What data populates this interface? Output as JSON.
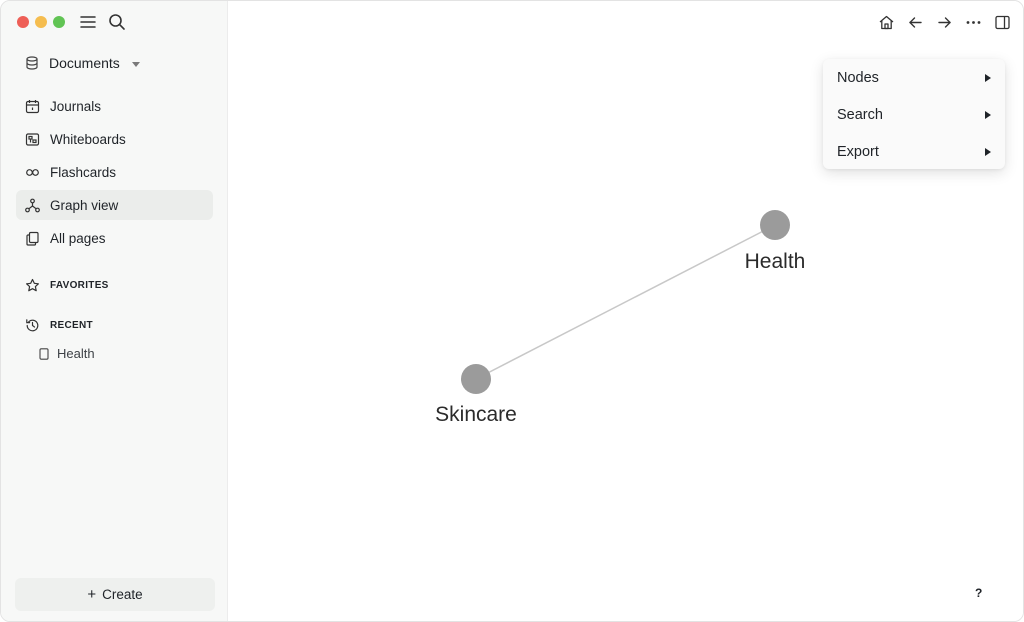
{
  "sidebar": {
    "graph_name": "Documents",
    "nav": [
      {
        "label": "Journals",
        "icon": "calendar-icon"
      },
      {
        "label": "Whiteboards",
        "icon": "whiteboard-icon"
      },
      {
        "label": "Flashcards",
        "icon": "infinity-icon"
      },
      {
        "label": "Graph view",
        "icon": "graph-icon",
        "active": true
      },
      {
        "label": "All pages",
        "icon": "pages-icon"
      }
    ],
    "favorites_title": "FAVORITES",
    "recent_title": "RECENT",
    "recent_items": [
      {
        "label": "Health",
        "icon": "page-icon"
      }
    ],
    "create_plus": "+",
    "create_label": "Create"
  },
  "toolbar": {
    "icons": [
      "home-icon",
      "arrow-left-icon",
      "arrow-right-icon",
      "more-icon",
      "sidebar-toggle-icon"
    ]
  },
  "graph": {
    "nodes": [
      {
        "id": "health",
        "label": "Health"
      },
      {
        "id": "skincare",
        "label": "Skincare"
      }
    ],
    "edges": [
      {
        "from": "skincare",
        "to": "health"
      }
    ],
    "node_color": "#9b9b9b",
    "edge_color": "#c8c8c8"
  },
  "menu": {
    "items": [
      {
        "label": "Nodes"
      },
      {
        "label": "Search"
      },
      {
        "label": "Export"
      }
    ]
  },
  "help_label": "?"
}
